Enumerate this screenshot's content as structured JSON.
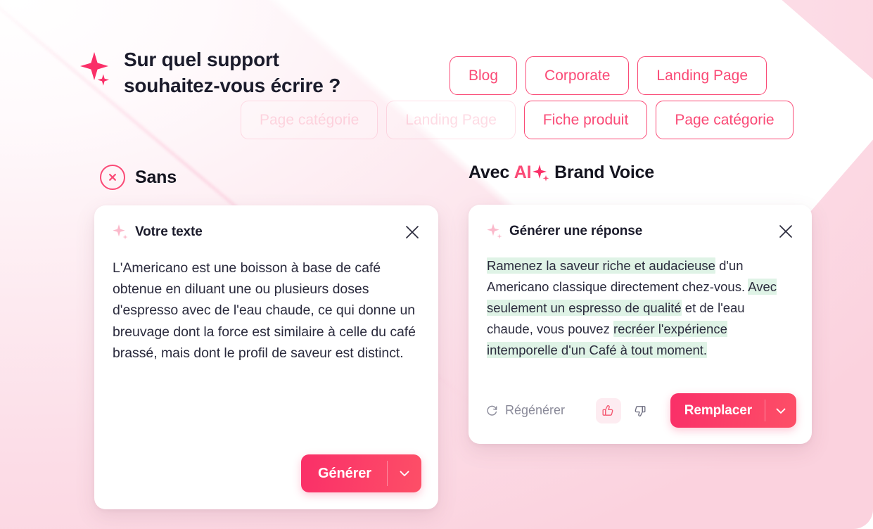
{
  "theme": {
    "accent": "#fa4a76",
    "accent_deep": "#fa2f68",
    "accent_light": "#fd4f67",
    "highlight_green": "#dff3e6",
    "text_dark": "#1b1b2b",
    "text_muted": "#8a8a99",
    "card_bg": "#ffffff",
    "page_bg_start": "#ffffff",
    "page_bg_end": "#fbd2de"
  },
  "header": {
    "sparkle_icon": "sparkle-icon",
    "headline": "Sur quel support\nsouhaitez-vous écrire ?",
    "tags_row1": [
      {
        "label": "Blog",
        "state": "active"
      },
      {
        "label": "Corporate",
        "state": "active"
      },
      {
        "label": "Landing Page",
        "state": "active"
      }
    ],
    "tags_row2": [
      {
        "label": "Page catégorie",
        "state": "faded"
      },
      {
        "label": "Landing Page",
        "state": "faded"
      },
      {
        "label": "Fiche produit",
        "state": "active"
      },
      {
        "label": "Page catégorie",
        "state": "active"
      }
    ]
  },
  "columns": {
    "left": {
      "icon": "x-circle-icon",
      "title": "Sans"
    },
    "right": {
      "prefix": "Avec ",
      "brand": "AI",
      "brand_icon": "sparkle-icon",
      "suffix": " Brand Voice"
    }
  },
  "card_left": {
    "sparkle_icon": "sparkle-icon",
    "title": "Votre texte",
    "close_icon": "close-icon",
    "body": "L'Americano est une boisson à base de café obtenue en diluant une ou plusieurs doses d'espresso avec de l'eau chaude, ce qui donne un breuvage dont la force est similaire à celle du café brassé, mais dont le profil de saveur est distinct.",
    "primary_button": "Générer",
    "caret_icon": "chevron-down-icon"
  },
  "card_right": {
    "sparkle_icon": "sparkle-icon",
    "title": "Générer une réponse",
    "close_icon": "close-icon",
    "body_segments": [
      {
        "text": "Ramenez la saveur riche et audacieuse",
        "highlight": true
      },
      {
        "text": " d'un Americano classique directement chez-vous. ",
        "highlight": false
      },
      {
        "text": "Avec seulement un espresso de qualité",
        "highlight": true
      },
      {
        "text": " et de l'eau chaude, vous pouvez ",
        "highlight": false
      },
      {
        "text": "recréer l'expérience intemporelle d'un Café à tout moment.",
        "highlight": true
      }
    ],
    "regenerate_label": "Régénérer",
    "regenerate_icon": "refresh-icon",
    "thumbs_up_icon": "thumbs-up-icon",
    "thumbs_down_icon": "thumbs-down-icon",
    "thumbs_up_active": true,
    "primary_button": "Remplacer",
    "caret_icon": "chevron-down-icon"
  }
}
